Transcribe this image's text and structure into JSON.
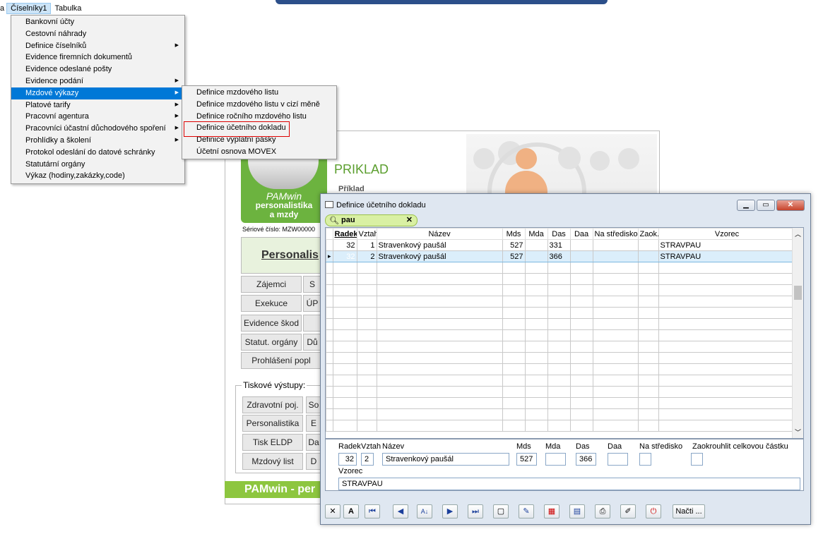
{
  "menubar": {
    "cut_item": "a",
    "items": [
      "Číselníky1",
      "Tabulka"
    ]
  },
  "menu_main": [
    {
      "label": "Bankovní účty",
      "sub": false
    },
    {
      "label": "Cestovní náhrady",
      "sub": false
    },
    {
      "label": "Definice číselníků",
      "sub": true
    },
    {
      "label": "Evidence firemních dokumentů",
      "sub": false
    },
    {
      "label": "Evidence odeslané pošty",
      "sub": false
    },
    {
      "label": "Evidence podání",
      "sub": true
    },
    {
      "label": "Mzdové výkazy",
      "sub": true,
      "selected": true
    },
    {
      "label": "Platové tarify",
      "sub": true
    },
    {
      "label": "Pracovní agentura",
      "sub": true
    },
    {
      "label": "Pracovníci  účastní důchodového spoření",
      "sub": true
    },
    {
      "label": "Prohlídky a školení",
      "sub": true
    },
    {
      "label": "Protokol odeslání do datové schránky",
      "sub": false
    },
    {
      "label": "Statutární orgány",
      "sub": false
    },
    {
      "label": "Výkaz (hodiny,zakázky,code)",
      "sub": false
    }
  ],
  "menu_sub": [
    "Definice mzdového listu",
    "Definice mzdového listu v cizí měně",
    "Definice ročního mzdového listu",
    "Definice účetního dokladu",
    "Definice výplatní pásky",
    "Účetní osnova MOVEX"
  ],
  "bg": {
    "logo_line1": "PAMwin",
    "logo_line2": "personalistika",
    "logo_line3": "a mzdy",
    "title": "PRIKLAD",
    "subtitle": "Příklad",
    "serial": "Sériové číslo: MZW00000",
    "pers": "Personalis",
    "buttons": [
      {
        "label": "Zájemci"
      },
      {
        "label": "S"
      },
      {
        "label": "Exekuce"
      },
      {
        "label": "ÚP"
      },
      {
        "label": "Evidence škod"
      },
      {
        "label": "Statut. orgány"
      },
      {
        "label": "Dů"
      },
      {
        "label": "Prohlášení popl"
      }
    ],
    "tisk_label": "Tiskové výstupy:",
    "tisk_buttons": [
      "Zdravotní poj.",
      "So",
      "Personalistika",
      "E",
      "Tisk ELDP",
      "Da",
      "Mzdový list",
      "D"
    ],
    "green_bar": "PAMwin - per"
  },
  "dialog": {
    "title": "Definice účetního dokladu",
    "search": "pau",
    "columns": [
      "Radek",
      "Vztah",
      "Název",
      "Mds",
      "Mda",
      "Das",
      "Daa",
      "Na středisko",
      "Zaok.",
      "Vzorec"
    ],
    "rows": [
      {
        "radek": "32",
        "vztah": "1",
        "nazev": "Stravenkový paušál",
        "mds": "527",
        "mda": "",
        "das": "331",
        "daa": "",
        "stredisko": "",
        "zaok": "",
        "vzorec": "STRAVPAU"
      },
      {
        "radek": "32",
        "vztah": "2",
        "nazev": "Stravenkový paušál",
        "mds": "527",
        "mda": "",
        "das": "366",
        "daa": "",
        "stredisko": "",
        "zaok": "",
        "vzorec": "STRAVPAU"
      }
    ],
    "form": {
      "lbl_radek": "Radek",
      "lbl_vztah": "Vztah",
      "lbl_nazev": "Název",
      "lbl_mds": "Mds",
      "lbl_mda": "Mda",
      "lbl_das": "Das",
      "lbl_daa": "Daa",
      "lbl_stredisko": "Na středisko",
      "lbl_zaok": "Zaokrouhlit celkovou částku",
      "lbl_vzorec": "Vzorec",
      "radek": "32",
      "vztah": "2",
      "nazev": "Stravenkový paušál",
      "mds": "527",
      "mda": "",
      "das": "366",
      "daa": "",
      "vzorec": "STRAVPAU"
    },
    "toolbar": {
      "nacti": "Načti ..."
    }
  },
  "colors": {
    "menu_selected": "#0078d7",
    "search_bg": "#d9f0a3",
    "logo_green": "#6cb33f",
    "highlight_red": "#dd0000"
  }
}
